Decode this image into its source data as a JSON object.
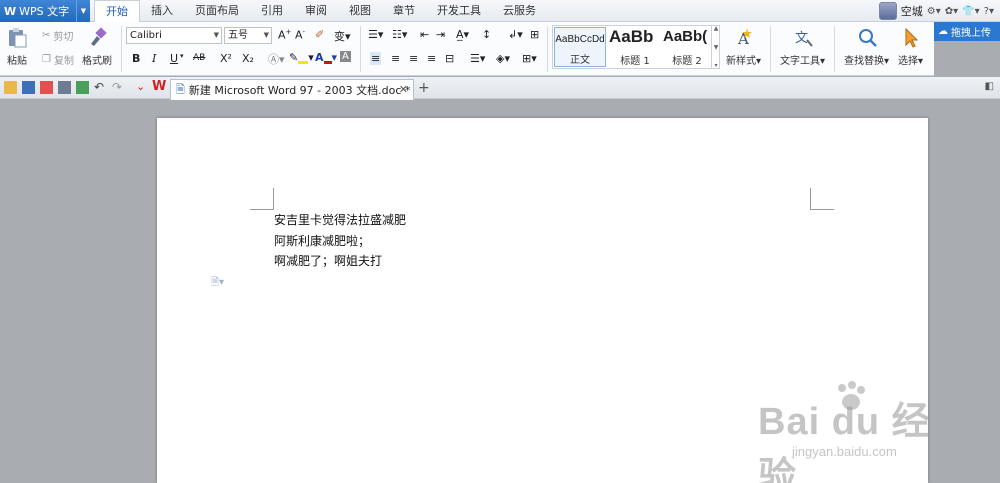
{
  "app": {
    "logo": "W",
    "name": "WPS 文字"
  },
  "menu_tabs": [
    {
      "label": "开始",
      "active": true
    },
    {
      "label": "插入"
    },
    {
      "label": "页面布局"
    },
    {
      "label": "引用"
    },
    {
      "label": "审阅"
    },
    {
      "label": "视图"
    },
    {
      "label": "章节"
    },
    {
      "label": "开发工具"
    },
    {
      "label": "云服务"
    }
  ],
  "user": {
    "name": "空城"
  },
  "cloud_button": "拖拽上传",
  "ribbon": {
    "paste": "粘贴",
    "cut": "剪切",
    "copy": "复制",
    "format_painter": "格式刷",
    "font_name": "Calibri",
    "font_size": "五号",
    "bold": "B",
    "italic": "I",
    "underline": "U",
    "strikethrough": "AB",
    "superscript": "X²",
    "subscript": "X₂",
    "styles": [
      {
        "preview": "AaBbCcDd",
        "label": "正文",
        "selected": true
      },
      {
        "preview": "AaBb",
        "label": "标题 1"
      },
      {
        "preview": "AaBb(",
        "label": "标题 2"
      }
    ],
    "new_style": "新样式",
    "text_tools": "文字工具",
    "find_replace": "查找替换",
    "select": "选择"
  },
  "document_tab": {
    "title": "新建 Microsoft Word 97 - 2003 文档.doc *"
  },
  "document": {
    "lines": [
      "安吉里卡觉得法拉盛减肥",
      "阿斯利康减肥啦；",
      "啊减肥了；啊姐夫打"
    ]
  },
  "watermark": {
    "brand": "Bai du 经验",
    "url": "jingyan.baidu.com"
  },
  "colors": {
    "accent": "#2468b8",
    "highlight": "#f5e600",
    "font_color": "#d01010"
  }
}
